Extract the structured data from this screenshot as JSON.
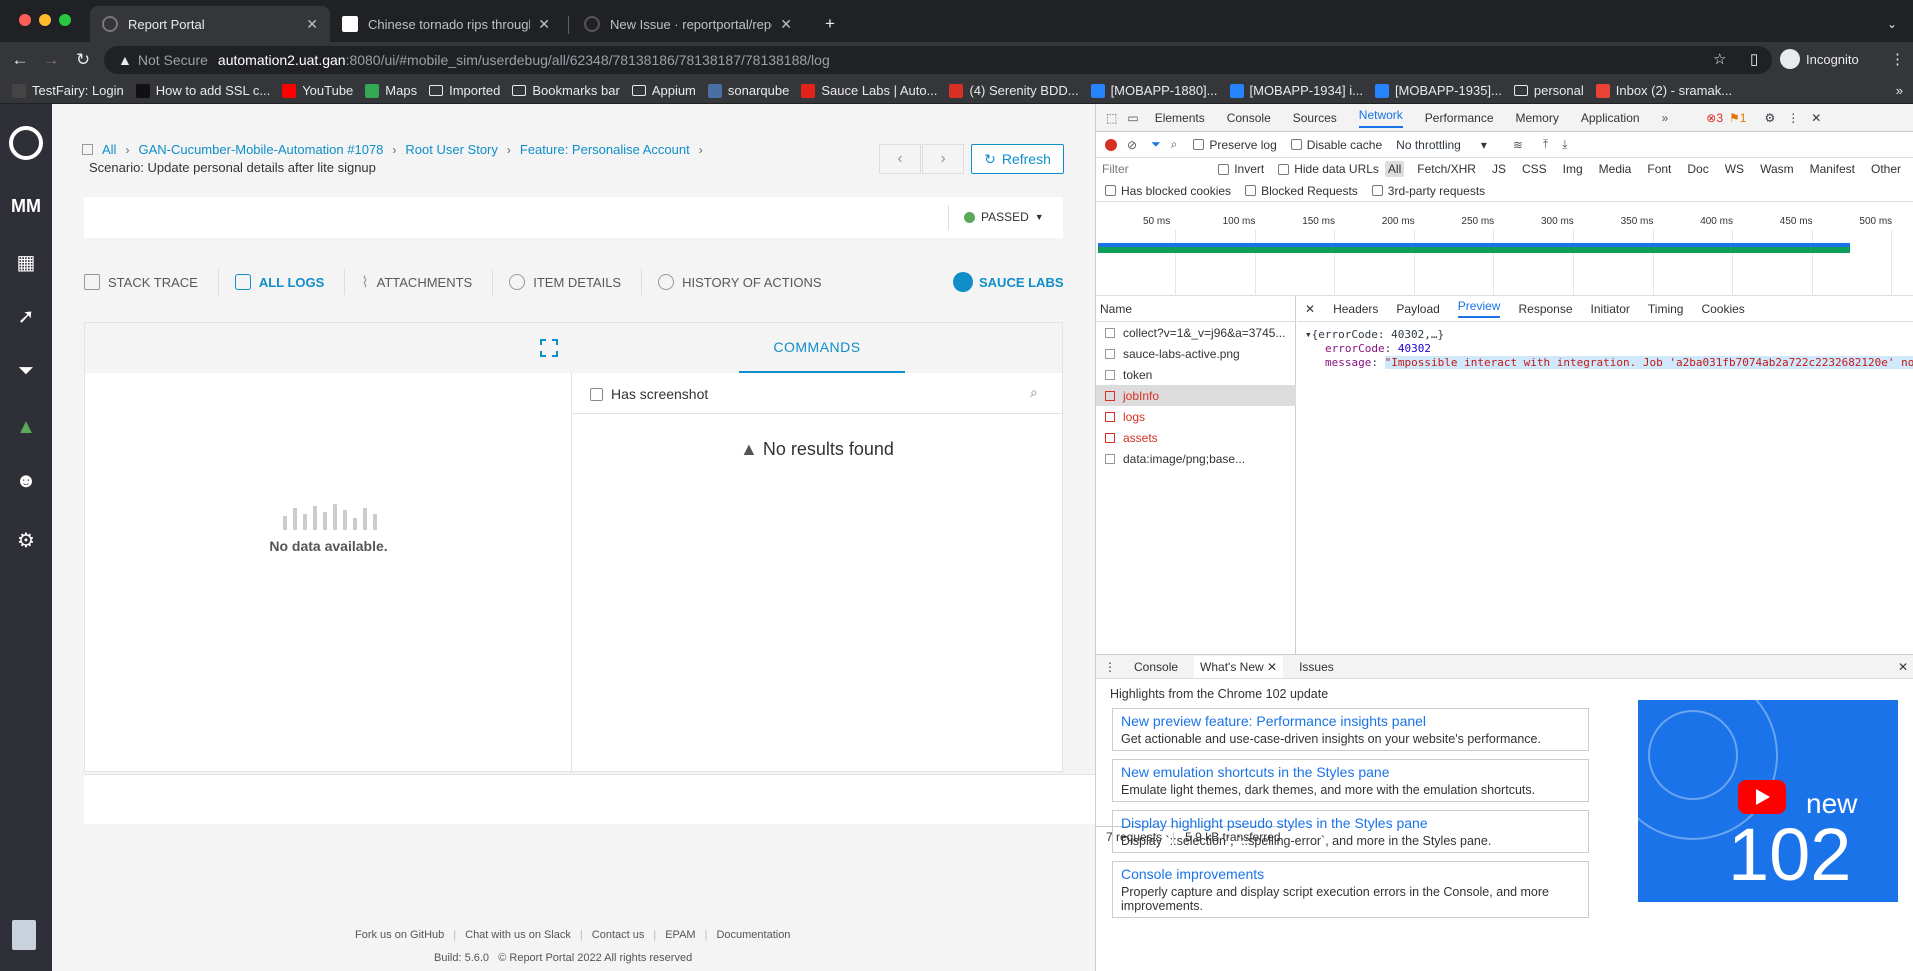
{
  "browser": {
    "tabs": [
      {
        "title": "Report Portal",
        "active": true
      },
      {
        "title": "Chinese tornado rips through b",
        "active": false
      },
      {
        "title": "New Issue · reportportal/report",
        "active": false
      }
    ],
    "address": {
      "security": "Not Secure",
      "host": "automation2.uat.gan",
      "rest": ":8080/ui/#mobile_sim/userdebug/all/62348/78138186/78138187/78138188/log"
    },
    "profile": "Incognito",
    "bookmarks": [
      {
        "label": "TestFairy: Login",
        "color": "#444"
      },
      {
        "label": "How to add SSL c...",
        "color": "#111"
      },
      {
        "label": "YouTube",
        "color": "#ff0000"
      },
      {
        "label": "Maps",
        "color": "#34a853"
      },
      {
        "label": "Imported",
        "folder": true
      },
      {
        "label": "Bookmarks bar",
        "folder": true
      },
      {
        "label": "Appium",
        "folder": true
      },
      {
        "label": "sonarqube",
        "color": "#4a6fa5"
      },
      {
        "label": "Sauce Labs | Auto...",
        "color": "#e2231a"
      },
      {
        "label": "(4) Serenity BDD...",
        "color": "#d93025"
      },
      {
        "label": "[MOBAPP-1880]...",
        "color": "#2684ff"
      },
      {
        "label": "[MOBAPP-1934] i...",
        "color": "#2684ff"
      },
      {
        "label": "[MOBAPP-1935]...",
        "color": "#2684ff"
      },
      {
        "label": "personal",
        "folder": true
      },
      {
        "label": "Inbox (2) - sramak...",
        "color": "#ea4335"
      }
    ]
  },
  "app": {
    "sidebar_brand": "MM",
    "breadcrumbs": [
      "All",
      "GAN-Cucumber-Mobile-Automation #1078",
      "Root User Story",
      "Feature: Personalise Account"
    ],
    "scenario": "Scenario: Update personal details after lite signup",
    "refresh_label": "Refresh",
    "status": "PASSED",
    "log_tabs": [
      "STACK TRACE",
      "ALL LOGS",
      "ATTACHMENTS",
      "ITEM DETAILS",
      "HISTORY OF ACTIONS"
    ],
    "sauce_labs": "SAUCE LABS",
    "no_data": "No data available.",
    "commands_tab": "COMMANDS",
    "has_screenshot": "Has screenshot",
    "no_results": "No results found",
    "footer_links": [
      "Fork us on GitHub",
      "Chat with us on Slack",
      "Contact us",
      "EPAM",
      "Documentation"
    ],
    "build": "Build: 5.6.0",
    "copyright": "© Report Portal 2022 All rights reserved"
  },
  "devtools": {
    "panels": [
      "Elements",
      "Console",
      "Sources",
      "Network",
      "Performance",
      "Memory",
      "Application"
    ],
    "errors": "3",
    "warnings": "1",
    "preserve_log": "Preserve log",
    "disable_cache": "Disable cache",
    "throttling": "No throttling",
    "filter_placeholder": "Filter",
    "invert": "Invert",
    "hide_data_urls": "Hide data URLs",
    "types": [
      "All",
      "Fetch/XHR",
      "JS",
      "CSS",
      "Img",
      "Media",
      "Font",
      "Doc",
      "WS",
      "Wasm",
      "Manifest",
      "Other"
    ],
    "has_blocked_cookies": "Has blocked cookies",
    "blocked_requests": "Blocked Requests",
    "third_party": "3rd-party requests",
    "ticks": [
      "50 ms",
      "100 ms",
      "150 ms",
      "200 ms",
      "250 ms",
      "300 ms",
      "350 ms",
      "400 ms",
      "450 ms",
      "500 ms"
    ],
    "name_header": "Name",
    "detail_tabs": [
      "Headers",
      "Payload",
      "Preview",
      "Response",
      "Initiator",
      "Timing",
      "Cookies"
    ],
    "requests": [
      {
        "name": "collect?v=1&_v=j96&a=3745...",
        "error": false
      },
      {
        "name": "sauce-labs-active.png",
        "error": false
      },
      {
        "name": "token",
        "error": false
      },
      {
        "name": "jobInfo",
        "error": true
      },
      {
        "name": "logs",
        "error": true
      },
      {
        "name": "assets",
        "error": true
      },
      {
        "name": "data:image/png;base...",
        "error": false
      }
    ],
    "requests_count": "7 requests",
    "transferred": "5.9 kB transferred",
    "preview": {
      "summary": "{errorCode: 40302,…}",
      "error_code_key": "errorCode",
      "error_code_val": "40302",
      "message_key": "message",
      "message_val": "\"Impossible interact with integration. Job 'a2ba031fb7074ab2a722c2232682120e' no"
    },
    "drawer_tabs": [
      "Console",
      "What's New",
      "Issues"
    ],
    "highlights": "Highlights from the Chrome 102 update",
    "cards": [
      {
        "title": "New preview feature: Performance insights panel",
        "desc": "Get actionable and use-case-driven insights on your website's performance."
      },
      {
        "title": "New emulation shortcuts in the Styles pane",
        "desc": "Emulate light themes, dark themes, and more with the emulation shortcuts."
      },
      {
        "title": "Display highlight pseudo styles in the Styles pane",
        "desc": "Display `::selection`, `::spelling-error`, and more in the Styles pane."
      },
      {
        "title": "Console improvements",
        "desc": "Properly capture and display script execution errors in the Console, and more improvements."
      }
    ],
    "promo_new": "new",
    "promo_version": "102"
  }
}
